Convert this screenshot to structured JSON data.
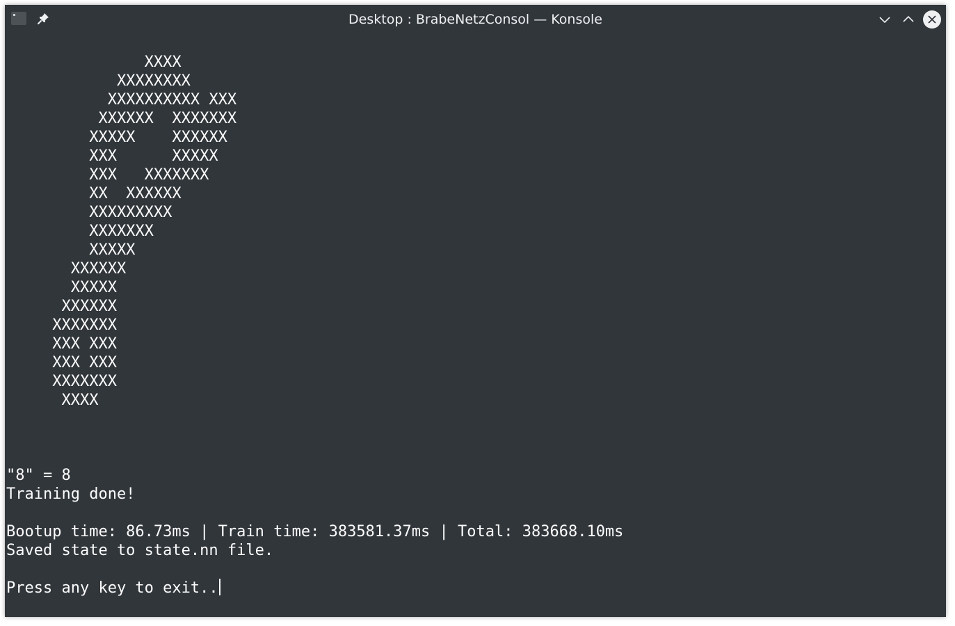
{
  "window": {
    "title": "Desktop : BrabeNetzConsol — Konsole"
  },
  "icons": {
    "app": "terminal-icon",
    "pin": "pin-icon",
    "minimize": "chevron-down-icon",
    "maximize": "chevron-up-icon",
    "close": "close-icon"
  },
  "colors": {
    "background": "#31363b",
    "foreground": "#fcfcfc"
  },
  "terminal": {
    "lines": [
      "               XXXX",
      "            XXXXXXXX",
      "           XXXXXXXXXX XXX",
      "          XXXXXX  XXXXXXX",
      "         XXXXX    XXXXXX",
      "         XXX      XXXXX",
      "         XXX   XXXXXXX",
      "         XX  XXXXXX",
      "         XXXXXXXXX",
      "         XXXXXXX",
      "         XXXXX",
      "       XXXXXX",
      "       XXXXX",
      "      XXXXXX",
      "     XXXXXXX",
      "     XXX XXX",
      "     XXX XXX",
      "     XXXXXXX",
      "      XXXX",
      "",
      "",
      "",
      "\"8\" = 8",
      "Training done!",
      "",
      "Bootup time: 86.73ms | Train time: 383581.37ms | Total: 383668.10ms",
      "Saved state to state.nn file.",
      "",
      "Press any key to exit.."
    ]
  }
}
